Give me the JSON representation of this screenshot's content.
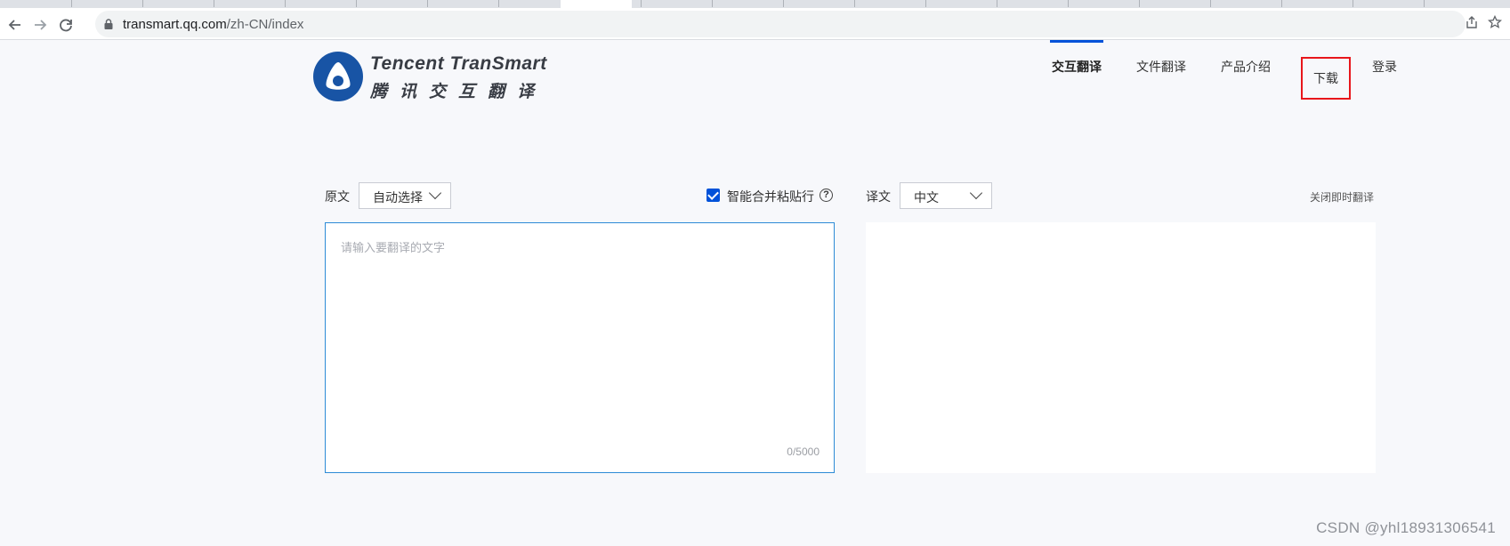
{
  "browser": {
    "url_host": "transmart.qq.com",
    "url_path": "/zh-CN/index",
    "icons": [
      "back-icon",
      "forward-icon",
      "reload-icon",
      "lock-icon",
      "share-icon",
      "bookmark-star-icon"
    ]
  },
  "logo": {
    "en": "Tencent TranSmart",
    "zh": "腾讯交互翻译"
  },
  "nav": {
    "items": [
      {
        "label": "交互翻译",
        "active": true
      },
      {
        "label": "文件翻译",
        "active": false
      },
      {
        "label": "产品介绍",
        "active": false
      },
      {
        "label": "下载",
        "active": false,
        "highlighted": true
      },
      {
        "label": "登录",
        "active": false
      }
    ]
  },
  "source": {
    "label": "原文",
    "language": "自动选择",
    "smart_merge_label": "智能合并粘贴行",
    "smart_merge_checked": true,
    "placeholder": "请输入要翻译的文字",
    "counter": "0/5000"
  },
  "target": {
    "label": "译文",
    "language": "中文",
    "close_instant_label": "关闭即时翻译"
  },
  "watermark": "CSDN @yhl18931306541",
  "colors": {
    "brand_blue": "#0052d9",
    "logo_blue": "#1854a5",
    "input_border": "#2d8bd6",
    "highlight_red": "#e8161b"
  }
}
